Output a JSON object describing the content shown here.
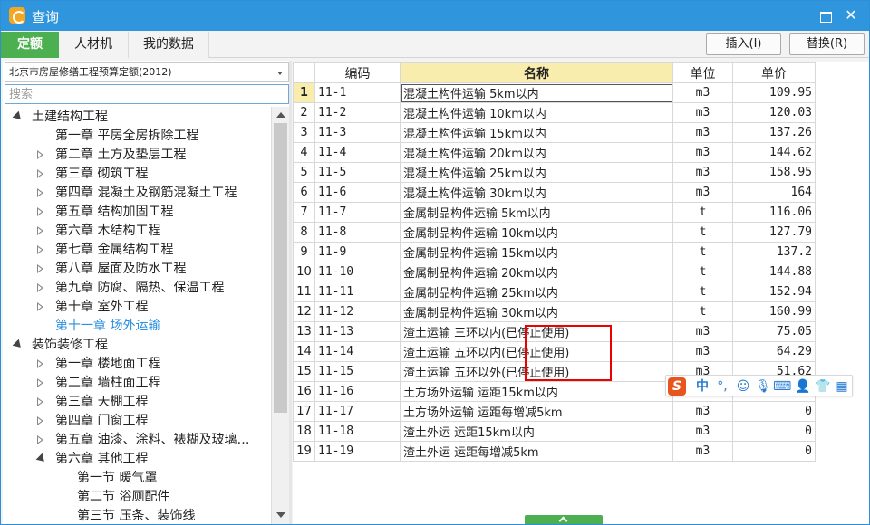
{
  "window": {
    "title": "查询",
    "icons": {
      "app": "app-logo-icon",
      "minimize": "minimize-icon",
      "close": "close-icon"
    },
    "close_glyph": "✕"
  },
  "tabs": [
    "定额",
    "人材机",
    "我的数据"
  ],
  "toolbar": {
    "insert_label": "插入(I)",
    "replace_label": "替换(R)"
  },
  "library": {
    "selected": "北京市房屋修缮工程预算定额(2012)"
  },
  "search": {
    "placeholder": "搜索",
    "value": ""
  },
  "tree": [
    {
      "label": "土建结构工程",
      "level": 0,
      "state": "expanded"
    },
    {
      "label": "第一章  平房全房拆除工程",
      "level": 1,
      "state": "leaf"
    },
    {
      "label": "第二章  土方及垫层工程",
      "level": 1,
      "state": "collapsed"
    },
    {
      "label": "第三章  砌筑工程",
      "level": 1,
      "state": "collapsed"
    },
    {
      "label": "第四章  混凝土及钢筋混凝土工程",
      "level": 1,
      "state": "collapsed"
    },
    {
      "label": "第五章  结构加固工程",
      "level": 1,
      "state": "collapsed"
    },
    {
      "label": "第六章  木结构工程",
      "level": 1,
      "state": "collapsed"
    },
    {
      "label": "第七章  金属结构工程",
      "level": 1,
      "state": "collapsed"
    },
    {
      "label": "第八章  屋面及防水工程",
      "level": 1,
      "state": "collapsed"
    },
    {
      "label": "第九章  防腐、隔热、保温工程",
      "level": 1,
      "state": "collapsed"
    },
    {
      "label": "第十章  室外工程",
      "level": 1,
      "state": "collapsed"
    },
    {
      "label": "第十一章  场外运输",
      "level": 1,
      "state": "leaf",
      "selected": true
    },
    {
      "label": "装饰装修工程",
      "level": 0,
      "state": "expanded"
    },
    {
      "label": "第一章  楼地面工程",
      "level": 1,
      "state": "collapsed"
    },
    {
      "label": "第二章  墙柱面工程",
      "level": 1,
      "state": "collapsed"
    },
    {
      "label": "第三章  天棚工程",
      "level": 1,
      "state": "collapsed"
    },
    {
      "label": "第四章  门窗工程",
      "level": 1,
      "state": "collapsed"
    },
    {
      "label": "第五章  油漆、涂料、裱糊及玻璃…",
      "level": 1,
      "state": "collapsed"
    },
    {
      "label": "第六章  其他工程",
      "level": 1,
      "state": "expanded"
    },
    {
      "label": "第一节  暖气罩",
      "level": 2,
      "state": "leaf"
    },
    {
      "label": "第二节  浴厕配件",
      "level": 2,
      "state": "leaf"
    },
    {
      "label": "第三节  压条、装饰线",
      "level": 2,
      "state": "leaf"
    }
  ],
  "table": {
    "columns": [
      "",
      "编码",
      "名称",
      "单位",
      "单价"
    ],
    "rows": [
      {
        "n": "1",
        "code": "11-1",
        "name": "混凝土构件运输 5km以内",
        "unit": "m3",
        "price": "109.95"
      },
      {
        "n": "2",
        "code": "11-2",
        "name": "混凝土构件运输 10km以内",
        "unit": "m3",
        "price": "120.03"
      },
      {
        "n": "3",
        "code": "11-3",
        "name": "混凝土构件运输 15km以内",
        "unit": "m3",
        "price": "137.26"
      },
      {
        "n": "4",
        "code": "11-4",
        "name": "混凝土构件运输 20km以内",
        "unit": "m3",
        "price": "144.62"
      },
      {
        "n": "5",
        "code": "11-5",
        "name": "混凝土构件运输 25km以内",
        "unit": "m3",
        "price": "158.95"
      },
      {
        "n": "6",
        "code": "11-6",
        "name": "混凝土构件运输 30km以内",
        "unit": "m3",
        "price": "164"
      },
      {
        "n": "7",
        "code": "11-7",
        "name": "金属制品构件运输 5km以内",
        "unit": "t",
        "price": "116.06"
      },
      {
        "n": "8",
        "code": "11-8",
        "name": "金属制品构件运输 10km以内",
        "unit": "t",
        "price": "127.79"
      },
      {
        "n": "9",
        "code": "11-9",
        "name": "金属制品构件运输 15km以内",
        "unit": "t",
        "price": "137.2"
      },
      {
        "n": "10",
        "code": "11-10",
        "name": "金属制品构件运输 20km以内",
        "unit": "t",
        "price": "144.88"
      },
      {
        "n": "11",
        "code": "11-11",
        "name": "金属制品构件运输 25km以内",
        "unit": "t",
        "price": "152.94"
      },
      {
        "n": "12",
        "code": "11-12",
        "name": "金属制品构件运输 30km以内",
        "unit": "t",
        "price": "160.99"
      },
      {
        "n": "13",
        "code": "11-13",
        "name": "渣土运输 三环以内(已停止使用)",
        "unit": "m3",
        "price": "75.05"
      },
      {
        "n": "14",
        "code": "11-14",
        "name": "渣土运输 五环以内(已停止使用)",
        "unit": "m3",
        "price": "64.29"
      },
      {
        "n": "15",
        "code": "11-15",
        "name": "渣土运输 五环以外(已停止使用)",
        "unit": "m3",
        "price": "51.62"
      },
      {
        "n": "16",
        "code": "11-16",
        "name": "土方场外运输 运距15km以内",
        "unit": "m3",
        "price": "0"
      },
      {
        "n": "17",
        "code": "11-17",
        "name": "土方场外运输 运距每增减5km",
        "unit": "m3",
        "price": "0"
      },
      {
        "n": "18",
        "code": "11-18",
        "name": "渣土外运 运距15km以内",
        "unit": "m3",
        "price": "0"
      },
      {
        "n": "19",
        "code": "11-19",
        "name": "渣土外运 运距每增减5km",
        "unit": "m3",
        "price": "0"
      }
    ]
  },
  "ime": {
    "lang_label": "中",
    "icons": [
      "sogou-logo-icon",
      "chinese-mode-icon",
      "punctuation-icon",
      "emoji-icon",
      "microphone-icon",
      "keyboard-icon",
      "user-icon",
      "skin-icon",
      "toolbox-icon"
    ]
  },
  "colors": {
    "titlebar": "#2f95dc",
    "active_tab": "#4caf50",
    "highlight": "#f9edae",
    "selected_tree": "#2a8fe0",
    "annotation_box": "#e00000"
  }
}
